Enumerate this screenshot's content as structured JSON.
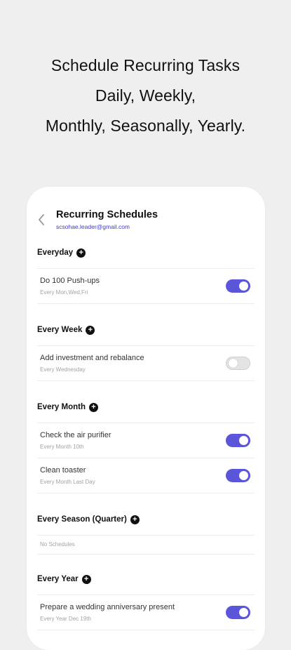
{
  "promo": {
    "line1": "Schedule Recurring Tasks",
    "line2": "Daily, Weekly,",
    "line3": "Monthly, Seasonally, Yearly."
  },
  "header": {
    "title": "Recurring Schedules",
    "email": "scsohae.leader@gmail.com"
  },
  "colors": {
    "accent": "#5a55d9",
    "email": "#3d3bd6",
    "background": "#efefef"
  },
  "sections": [
    {
      "title": "Everyday",
      "items": [
        {
          "name": "Do 100 Push-ups",
          "sub": "Every Mon,Wed,Fri",
          "enabled": true
        }
      ]
    },
    {
      "title": "Every Week",
      "items": [
        {
          "name": "Add investment and rebalance",
          "sub": "Every Wednesday",
          "enabled": false
        }
      ]
    },
    {
      "title": "Every Month",
      "items": [
        {
          "name": "Check the air purifier",
          "sub": "Every Month 10th",
          "enabled": true
        },
        {
          "name": "Clean toaster",
          "sub": "Every Month Last Day",
          "enabled": true
        }
      ]
    },
    {
      "title": "Every Season (Quarter)",
      "empty_text": "No Schedules",
      "items": []
    },
    {
      "title": "Every Year",
      "items": [
        {
          "name": "Prepare a wedding anniversary present",
          "sub": "Every Year Dec 19th",
          "enabled": true
        }
      ]
    }
  ]
}
